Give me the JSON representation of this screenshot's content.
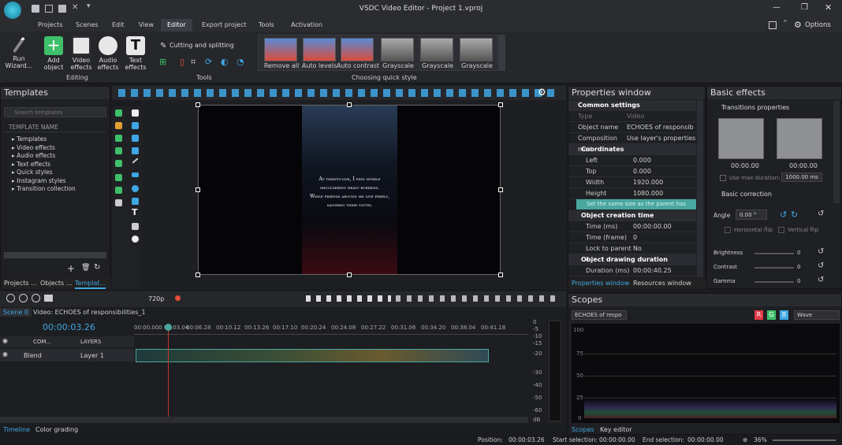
{
  "app": {
    "title": "VSDC Video Editor - Project 1.vproj",
    "options_label": "Options"
  },
  "menu": [
    "Projects",
    "Scenes",
    "Edit",
    "View",
    "Editor",
    "Export project",
    "Tools",
    "Activation"
  ],
  "ribbon": {
    "run_wizard": "Run\nWizard...",
    "add_object": "Add\nobject",
    "video_effects": "Video\neffects",
    "audio_effects": "Audio\neffects",
    "text_effects": "Text\neffects",
    "group_editing": "Editing",
    "cutting": "Cutting and splitting",
    "group_tools": "Tools",
    "quick_styles": [
      "Remove all",
      "Auto levels",
      "Auto contrast",
      "Grayscale",
      "Grayscale",
      "Grayscale"
    ],
    "group_quick": "Choosing quick style"
  },
  "templates": {
    "title": "Templates",
    "search_placeholder": "Search templates",
    "column": "TEMPLATE NAME",
    "items": [
      "Templates",
      "Video effects",
      "Audio effects",
      "Text effects",
      "Quick styles",
      "Instagram styles",
      "Transition collection"
    ],
    "tabs": [
      "Projects ...",
      "Objects ...",
      "Templat..."
    ]
  },
  "preview": {
    "text_lines": [
      "At twenty-one, I find myself",
      "shouldering heavy burdens.",
      "While friends around me live freely,",
      "savoring their youth."
    ]
  },
  "properties": {
    "title": "Properties window",
    "common": "Common settings",
    "type_label": "Type",
    "type_value": "Video",
    "name_label": "Object name",
    "name_value": "ECHOES of responsib",
    "comp_label": "Composition mod",
    "comp_value": "Use layer's properties",
    "coords": "Coordinates",
    "rows": [
      {
        "k": "Left",
        "v": "0.000"
      },
      {
        "k": "Top",
        "v": "0.000"
      },
      {
        "k": "Width",
        "v": "1920.000"
      },
      {
        "k": "Height",
        "v": "1080.000"
      }
    ],
    "same_btn": "Set the same size as the parent has",
    "creation": "Object creation time",
    "time_ms": "Time (ms)",
    "time_ms_v": "00:00:00.00",
    "time_frame": "Time (frame)",
    "time_frame_v": "0",
    "lock": "Lock to parent c",
    "lock_v": "No",
    "drawing": "Object drawing duration",
    "dur": "Duration (ms)",
    "dur_v": "00:00:40.25",
    "tabs": [
      "Properties window",
      "Resources window"
    ]
  },
  "basic": {
    "title": "Basic effects",
    "transitions": "Transitions properties",
    "t1": "00:00.00",
    "t2": "00:00.00",
    "use_max": "Use max duration:",
    "max_val": "1000.00 ms",
    "correction": "Basic correction",
    "angle_label": "Angle",
    "angle_value": "0.00 °",
    "hflip": "Horizontal flip",
    "vflip": "Vertical flip",
    "sliders": [
      {
        "k": "Brightness",
        "v": "0"
      },
      {
        "k": "Contrast",
        "v": "0"
      },
      {
        "k": "Gamma",
        "v": "0"
      }
    ]
  },
  "timeline": {
    "res": "720p",
    "scene_tab": "Scene 0",
    "video_tab": "Video: ECHOES of responsibilities_1",
    "time": "00:00:03.26",
    "ruler": [
      "00:00.000",
      "00:03.04",
      "00:06.28",
      "00:10.12",
      "00:13.26",
      "00:17.10",
      "00:20.24",
      "00:24.08",
      "00:27.22",
      "00:31.06",
      "00:34.20",
      "00:38.04",
      "00:41.18"
    ],
    "com": "COM...",
    "layers": "LAYERS",
    "blend": "Blend",
    "layer": "Layer 1",
    "db": [
      "0",
      "-5",
      "-10",
      "-15",
      "-20",
      "-30",
      "-40",
      "-50",
      "-60",
      "dB"
    ],
    "tabs": [
      "Timeline",
      "Color grading"
    ]
  },
  "scopes": {
    "title": "Scopes",
    "source": "ECHOES of respo",
    "r": "R",
    "g": "G",
    "b": "B",
    "mode": "Wave",
    "levels": [
      "100",
      "75",
      "50",
      "25",
      "0"
    ],
    "tabs": [
      "Scopes",
      "Key editor"
    ]
  },
  "status": {
    "position": "Position:",
    "position_v": "00:00:03.26",
    "start": "Start selection:",
    "start_v": "00:00:00.00",
    "end": "End selection:",
    "end_v": "00:00:00.00",
    "zoom": "36%"
  },
  "colors": {
    "accent": "#3fa7e5",
    "teal": "#4aa7a0",
    "bg": "#1b1c1f"
  }
}
